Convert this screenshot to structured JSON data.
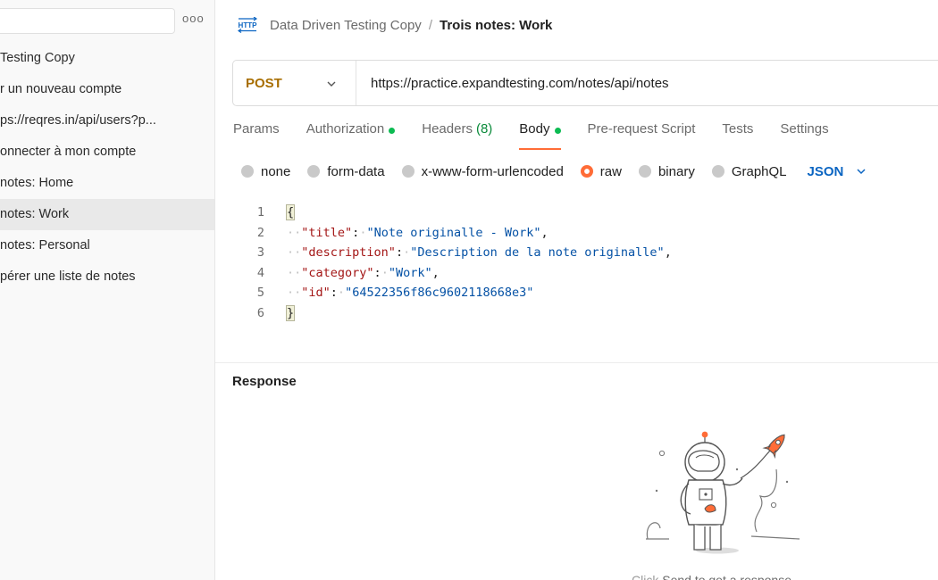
{
  "sidebar": {
    "items": [
      {
        "label": "Testing Copy",
        "active": false
      },
      {
        "label": "r un nouveau compte",
        "active": false
      },
      {
        "label": "ps://reqres.in/api/users?p...",
        "active": false
      },
      {
        "label": "onnecter à mon compte",
        "active": false
      },
      {
        "label": "notes: Home",
        "active": false
      },
      {
        "label": "notes: Work",
        "active": true
      },
      {
        "label": "notes: Personal",
        "active": false
      },
      {
        "label": "pérer une liste de notes",
        "active": false
      }
    ],
    "more_label": "ooo"
  },
  "breadcrumb": {
    "icon": "http-icon",
    "icon_text": "HTTP",
    "parent": "Data Driven Testing Copy",
    "separator": "/",
    "current": "Trois notes: Work"
  },
  "request": {
    "method": "POST",
    "url": "https://practice.expandtesting.com/notes/api/notes"
  },
  "tabs": [
    {
      "label": "Params",
      "dot": false,
      "count": ""
    },
    {
      "label": "Authorization",
      "dot": true,
      "count": ""
    },
    {
      "label": "Headers",
      "dot": false,
      "count": "(8)"
    },
    {
      "label": "Body",
      "dot": true,
      "count": "",
      "active": true
    },
    {
      "label": "Pre-request Script",
      "dot": false,
      "count": ""
    },
    {
      "label": "Tests",
      "dot": false,
      "count": ""
    },
    {
      "label": "Settings",
      "dot": false,
      "count": ""
    }
  ],
  "body_types": [
    {
      "label": "none",
      "selected": false
    },
    {
      "label": "form-data",
      "selected": false
    },
    {
      "label": "x-www-form-urlencoded",
      "selected": false
    },
    {
      "label": "raw",
      "selected": true
    },
    {
      "label": "binary",
      "selected": false
    },
    {
      "label": "GraphQL",
      "selected": false
    }
  ],
  "format_select": "JSON",
  "editor": {
    "line_numbers": [
      "1",
      "2",
      "3",
      "4",
      "5",
      "6"
    ],
    "open_brace": "{",
    "close_brace": "}",
    "fields": [
      {
        "key": "\"title\"",
        "value": "\"Note originalle - Work\"",
        "comma": ","
      },
      {
        "key": "\"description\"",
        "value": "\"Description de la note originalle\"",
        "comma": ","
      },
      {
        "key": "\"category\"",
        "value": "\"Work\"",
        "comma": ","
      },
      {
        "key": "\"id\"",
        "value": "\"64522356f86c9602118668e3\"",
        "comma": ""
      }
    ]
  },
  "response": {
    "label": "Response",
    "hint_click": "Click",
    "hint_rest": " Send to get a response"
  },
  "colors": {
    "accent": "#ff6c37",
    "method": "#a86e00",
    "dot": "#0cbb52",
    "json_select": "#0b65c2"
  }
}
